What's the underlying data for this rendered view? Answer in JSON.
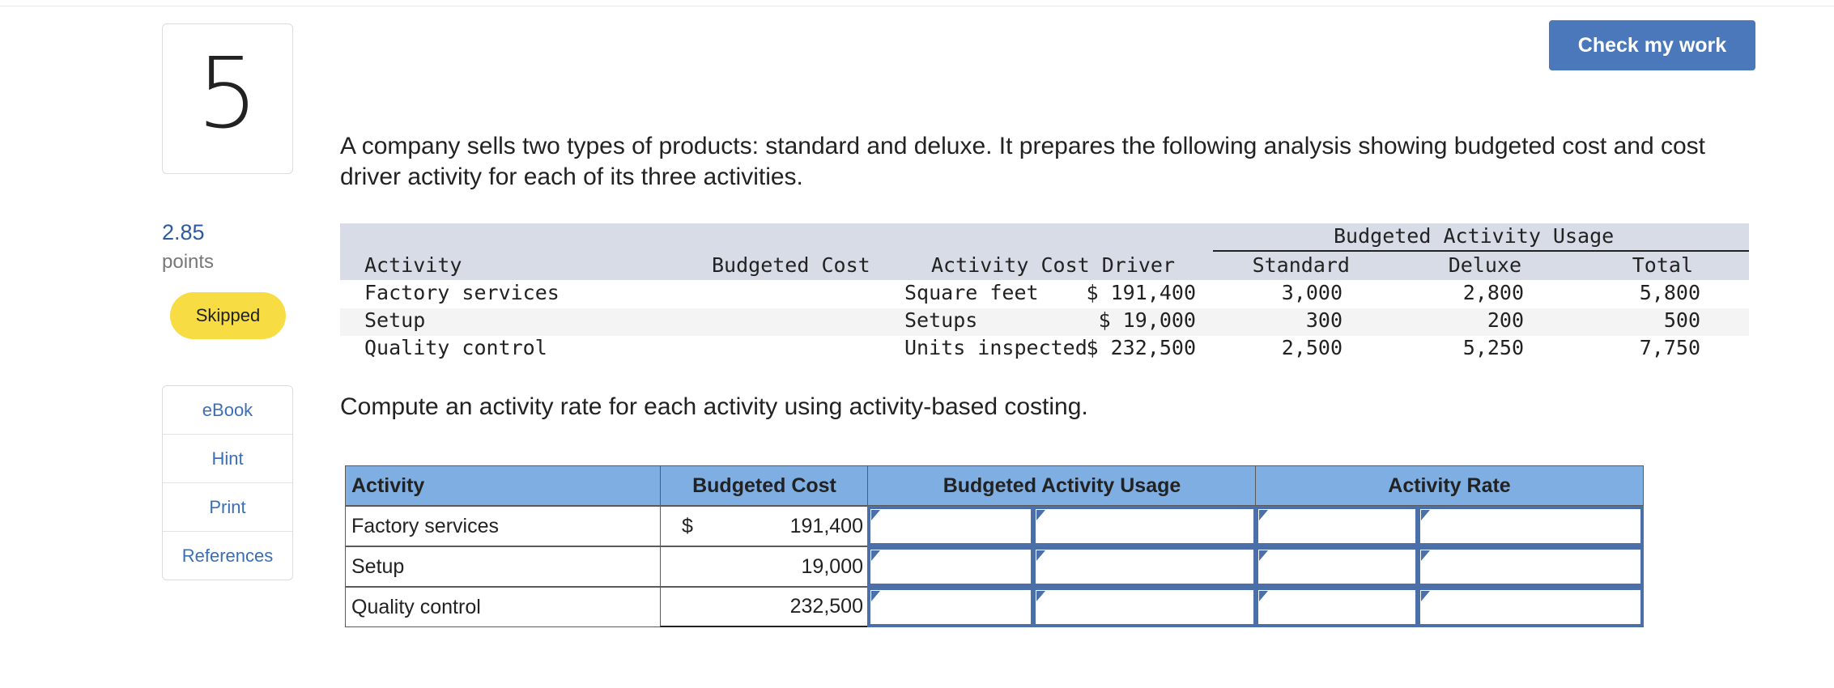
{
  "question": {
    "number": "5",
    "points_value": "2.85",
    "points_label": "points",
    "status": "Skipped"
  },
  "side_links": [
    "eBook",
    "Hint",
    "Print",
    "References"
  ],
  "check_button": "Check my work",
  "prompt": "A company sells two types of products: standard and deluxe. It prepares the following analysis showing budgeted cost and cost driver activity for each of its three activities.",
  "given_table": {
    "group_header": "Budgeted Activity Usage",
    "headers": [
      "Activity",
      "Budgeted Cost",
      "Activity Cost Driver",
      "Standard",
      "Deluxe",
      "Total"
    ],
    "rows": [
      [
        "Factory services",
        "$ 191,400",
        "Square feet",
        "3,000",
        "2,800",
        "5,800"
      ],
      [
        "Setup",
        "$ 19,000",
        "Setups",
        "300",
        "200",
        "500"
      ],
      [
        "Quality control",
        "$ 232,500",
        "Units inspected",
        "2,500",
        "5,250",
        "7,750"
      ]
    ]
  },
  "instruction": "Compute an activity rate for each activity using activity-based costing.",
  "answer_table": {
    "headers": [
      "Activity",
      "Budgeted Cost",
      "Budgeted Activity Usage",
      "Activity Rate"
    ],
    "currency_symbol": "$",
    "rows": [
      {
        "activity": "Factory services",
        "cost": "191,400"
      },
      {
        "activity": "Setup",
        "cost": "19,000"
      },
      {
        "activity": "Quality control",
        "cost": "232,500"
      }
    ]
  },
  "colors": {
    "accent": "#4a78ba",
    "header_blue": "#7faee2",
    "skipped_badge": "#f8dc44",
    "link": "#3a6fb5",
    "given_header_bg": "#d7dce6"
  }
}
